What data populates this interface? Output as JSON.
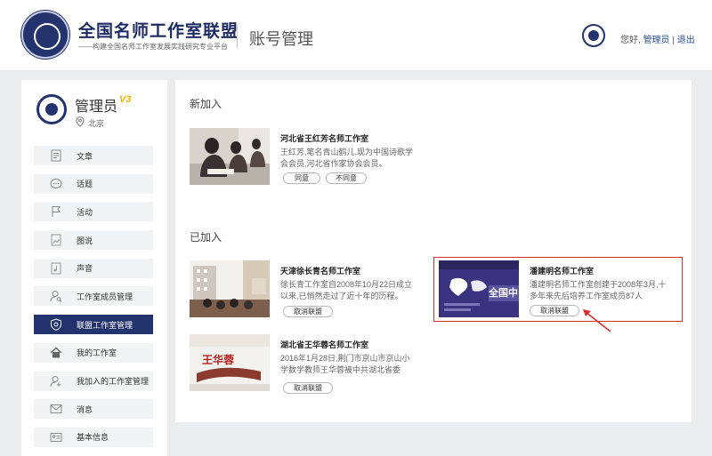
{
  "header": {
    "brand_title": "全国名师工作室联盟",
    "brand_subtitle": "——构建全国名师工作室发展实践研究专业平台",
    "page_name": "账号管理",
    "greeting": "您好,",
    "user_link": "管理员",
    "separator": "|",
    "logout": "退出"
  },
  "profile": {
    "name": "管理员",
    "vip_badge": "V3",
    "location": "北京"
  },
  "sidebar": {
    "items": [
      {
        "label": "文章",
        "icon": "document-icon"
      },
      {
        "label": "话题",
        "icon": "chat-bubble-icon"
      },
      {
        "label": "活动",
        "icon": "flag-icon"
      },
      {
        "label": "图说",
        "icon": "image-icon"
      },
      {
        "label": "声音",
        "icon": "audio-file-icon"
      },
      {
        "label": "工作室成员管理",
        "icon": "user-search-icon"
      },
      {
        "label": "联盟工作室管理",
        "icon": "shield-icon",
        "active": true
      },
      {
        "label": "我的工作室",
        "icon": "home-icon"
      },
      {
        "label": "我加入的工作室管理",
        "icon": "user-join-icon"
      },
      {
        "label": "消息",
        "icon": "envelope-icon"
      },
      {
        "label": "基本信息",
        "icon": "id-card-icon"
      }
    ]
  },
  "main": {
    "new_section": "新加入",
    "joined_section": "已加入",
    "new_cards": [
      {
        "title": "河北省王红芳名师工作室",
        "desc": "王红芳,笔名青山鹤儿,现为中国诗歌学会会员,河北省作家协会会员。",
        "accept": "同意",
        "reject": "不同意"
      }
    ],
    "joined_cards": [
      {
        "title": "天津徐长青名师工作室",
        "desc": "徐长青工作室自2008年10月22日成立以来,已悄然走过了近十年的历程。",
        "button": "取消联盟"
      },
      {
        "title": "潘建明名师工作室",
        "desc": "潘建明名师工作室创建于2008年3月,十多年来先后培养工作室成员87人",
        "button": "取消联盟",
        "thumb_text": "全国中"
      },
      {
        "title": "湖北省王华蓉名师工作室",
        "desc": "2016年1月28日,荆门市京山市京山小学数学教师王华蓉被中共湖北省委",
        "button": "取消联盟",
        "thumb_text": "王华蓉"
      }
    ]
  },
  "colors": {
    "brand": "#23336d",
    "highlight": "#d32f2f",
    "vip": "#f0b400"
  }
}
